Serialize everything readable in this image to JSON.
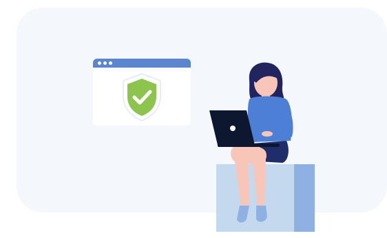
{
  "illustration": {
    "background_color": "#f4f7fb",
    "browser_bar_color": "#5b86cf",
    "shield_color": "#8cc44e",
    "shirt_color": "#4d7fd6",
    "skirt_color": "#1f2d6b",
    "hair_color": "#21245f",
    "skin_color": "#f7c6b8",
    "laptop_color": "#0e1730",
    "stool_front_color": "#c4d9ee",
    "stool_side_color": "#8fb0e3",
    "icons": [
      "browser-window-icon",
      "security-shield-icon",
      "checkmark-icon",
      "laptop-icon"
    ]
  }
}
